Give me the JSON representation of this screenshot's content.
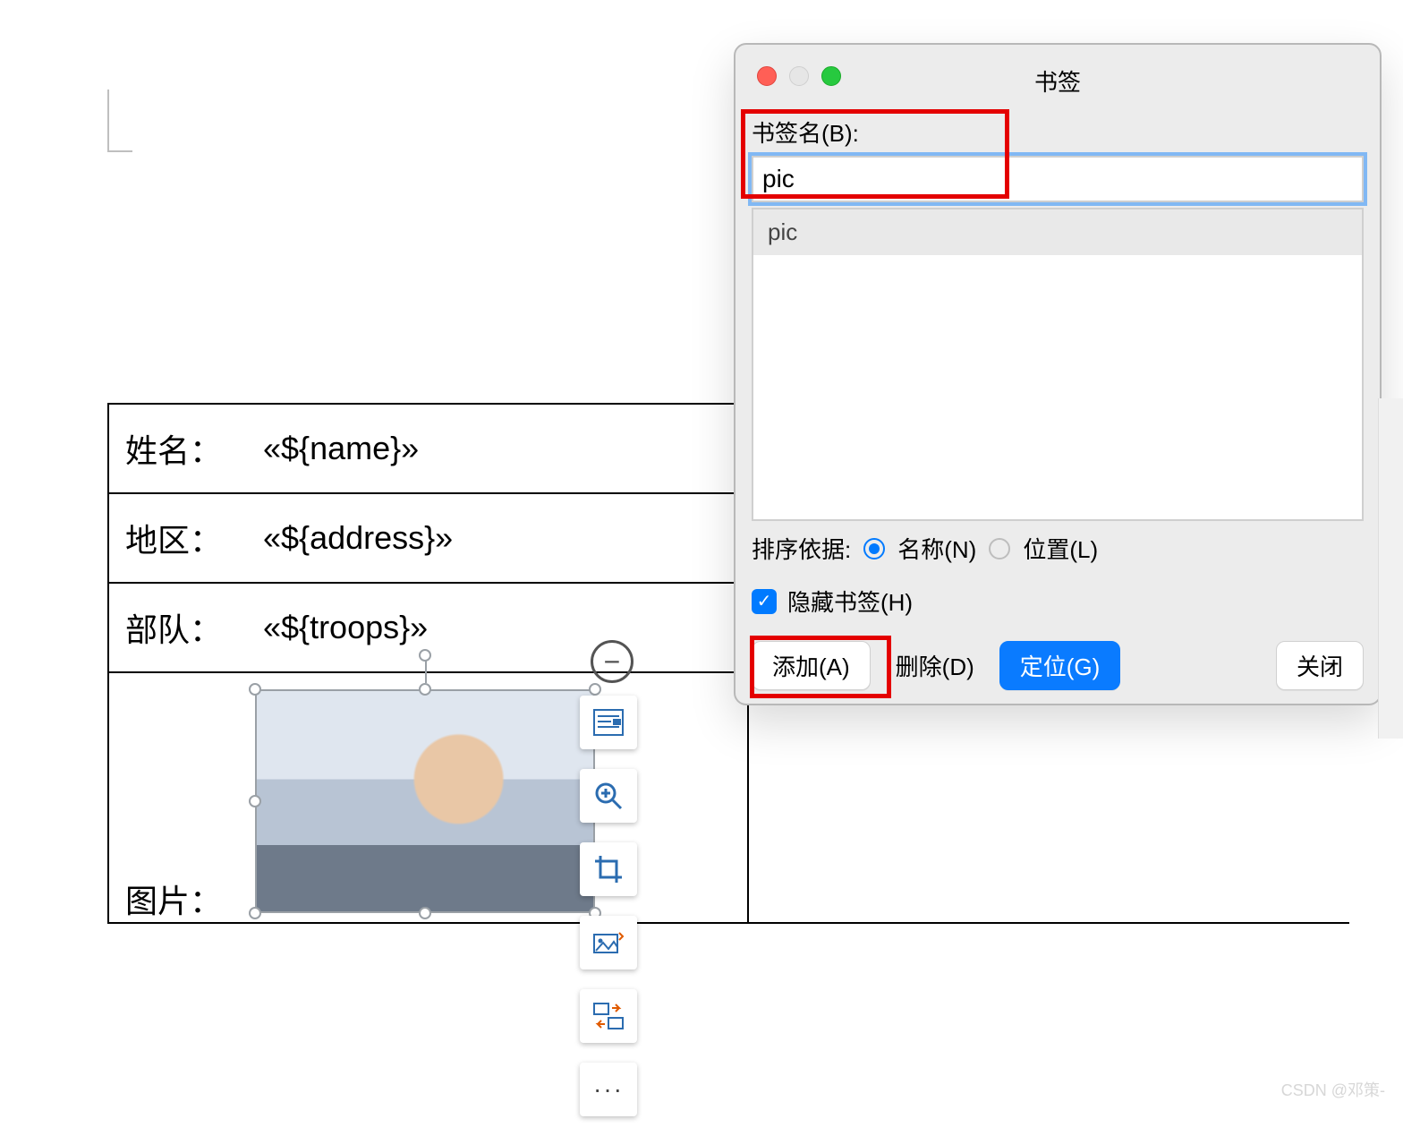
{
  "doc": {
    "rows": [
      {
        "label": "姓名：",
        "value": "«${name}»"
      },
      {
        "label": "地区：",
        "value": "«${address}»"
      },
      {
        "label": "部队：",
        "value": "«${troops}»"
      },
      {
        "label": "图片：",
        "value": ""
      }
    ]
  },
  "image_tools": {
    "collapse": "−",
    "layout_icon": "layout-options-icon",
    "zoom_icon": "zoom-in-icon",
    "crop_icon": "crop-icon",
    "replace_icon": "replace-image-icon",
    "rotate_icon": "convert-icon",
    "more": "···"
  },
  "dialog": {
    "title": "书签",
    "name_label": "书签名(B):",
    "name_value": "pic",
    "list": [
      "pic"
    ],
    "sort_label": "排序依据:",
    "sort_name": "名称(N)",
    "sort_pos": "位置(L)",
    "sort_selected": "name",
    "hide_label": "隐藏书签(H)",
    "hide_checked": true,
    "btn_add": "添加(A)",
    "btn_del": "删除(D)",
    "btn_goto": "定位(G)",
    "btn_close": "关闭"
  },
  "watermark": "CSDN @邓策-"
}
